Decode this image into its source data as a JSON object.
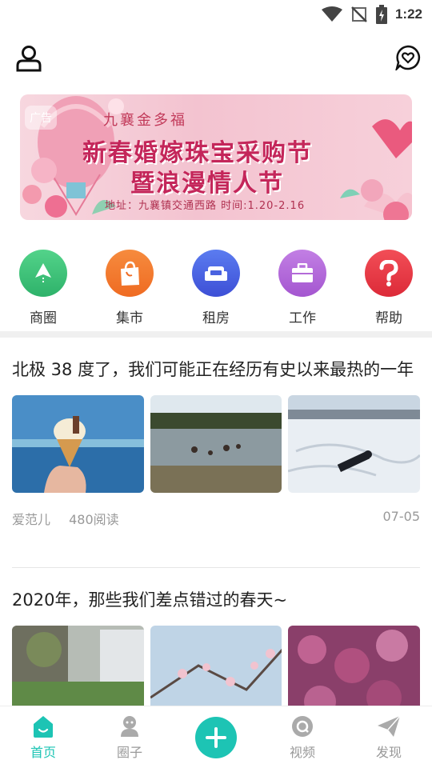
{
  "status_bar": {
    "time": "1:22"
  },
  "banner": {
    "ad_tag": "广告",
    "brand": "九襄金多福",
    "headline_1": "新春婚嫁珠宝采购节",
    "headline_2": "暨浪漫情人节",
    "info": "地址：九襄镇交通西路 时间:1.20-2.16"
  },
  "quick_nav": [
    {
      "label": "商圈",
      "color": "#3cc27a"
    },
    {
      "label": "集市",
      "color": "#f2792c"
    },
    {
      "label": "租房",
      "color": "#4a63e0"
    },
    {
      "label": "工作",
      "color": "#b36ad8"
    },
    {
      "label": "帮助",
      "color": "#ea3a46"
    }
  ],
  "articles": [
    {
      "title": "北极 38 度了，我们可能正在经历有史以来最热的一年",
      "author": "爱范儿",
      "reads": "480阅读",
      "date": "07-05"
    },
    {
      "title": "2020年，那些我们差点错过的春天~"
    }
  ],
  "tab_bar": {
    "home": "首页",
    "circle": "圈子",
    "video": "视频",
    "discover": "发现",
    "active_color": "#1dc4b4"
  }
}
